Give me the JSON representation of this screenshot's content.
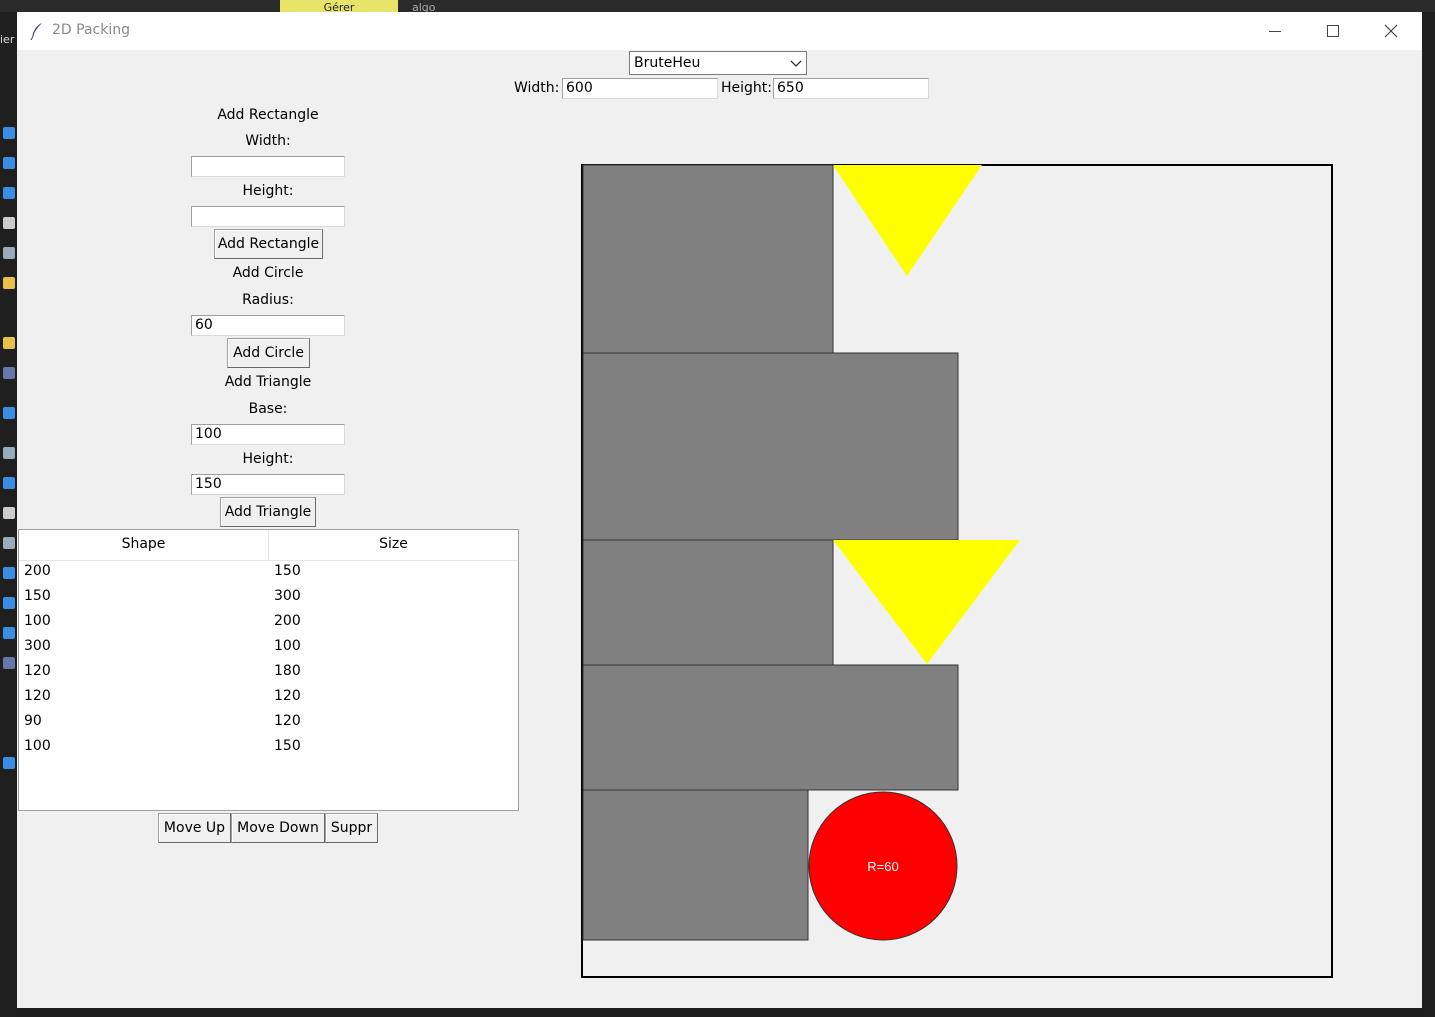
{
  "background": {
    "tab_label": "Gérer",
    "tab2_label": "algo",
    "left_text": "ier"
  },
  "window": {
    "title": "2D Packing"
  },
  "top": {
    "algorithm_selected": "BruteHeu",
    "width_label": "Width:",
    "width_value": "600",
    "height_label": "Height:",
    "height_value": "650"
  },
  "rectangle_form": {
    "heading": "Add Rectangle",
    "width_label": "Width:",
    "width_value": "",
    "height_label": "Height:",
    "height_value": "",
    "button": "Add Rectangle"
  },
  "circle_form": {
    "heading": "Add Circle",
    "radius_label": "Radius:",
    "radius_value": "60",
    "button": "Add Circle"
  },
  "triangle_form": {
    "heading": "Add Triangle",
    "base_label": "Base:",
    "base_value": "100",
    "height_label": "Height:",
    "height_value": "150",
    "button": "Add Triangle"
  },
  "table": {
    "columns": [
      "Shape",
      "Size"
    ],
    "rows": [
      [
        "200",
        "150"
      ],
      [
        "150",
        "300"
      ],
      [
        "100",
        "200"
      ],
      [
        "300",
        "100"
      ],
      [
        "120",
        "180"
      ],
      [
        "120",
        "120"
      ],
      [
        "90",
        "120"
      ],
      [
        "100",
        "150"
      ]
    ]
  },
  "actions": {
    "move_up": "Move Up",
    "move_down": "Move Down",
    "delete": "Suppr"
  },
  "canvas": {
    "circle_label": "R=60",
    "colors": {
      "rectangle": "#808080",
      "triangle": "#ffff00",
      "circle": "#ff0000",
      "border": "#000000"
    }
  }
}
